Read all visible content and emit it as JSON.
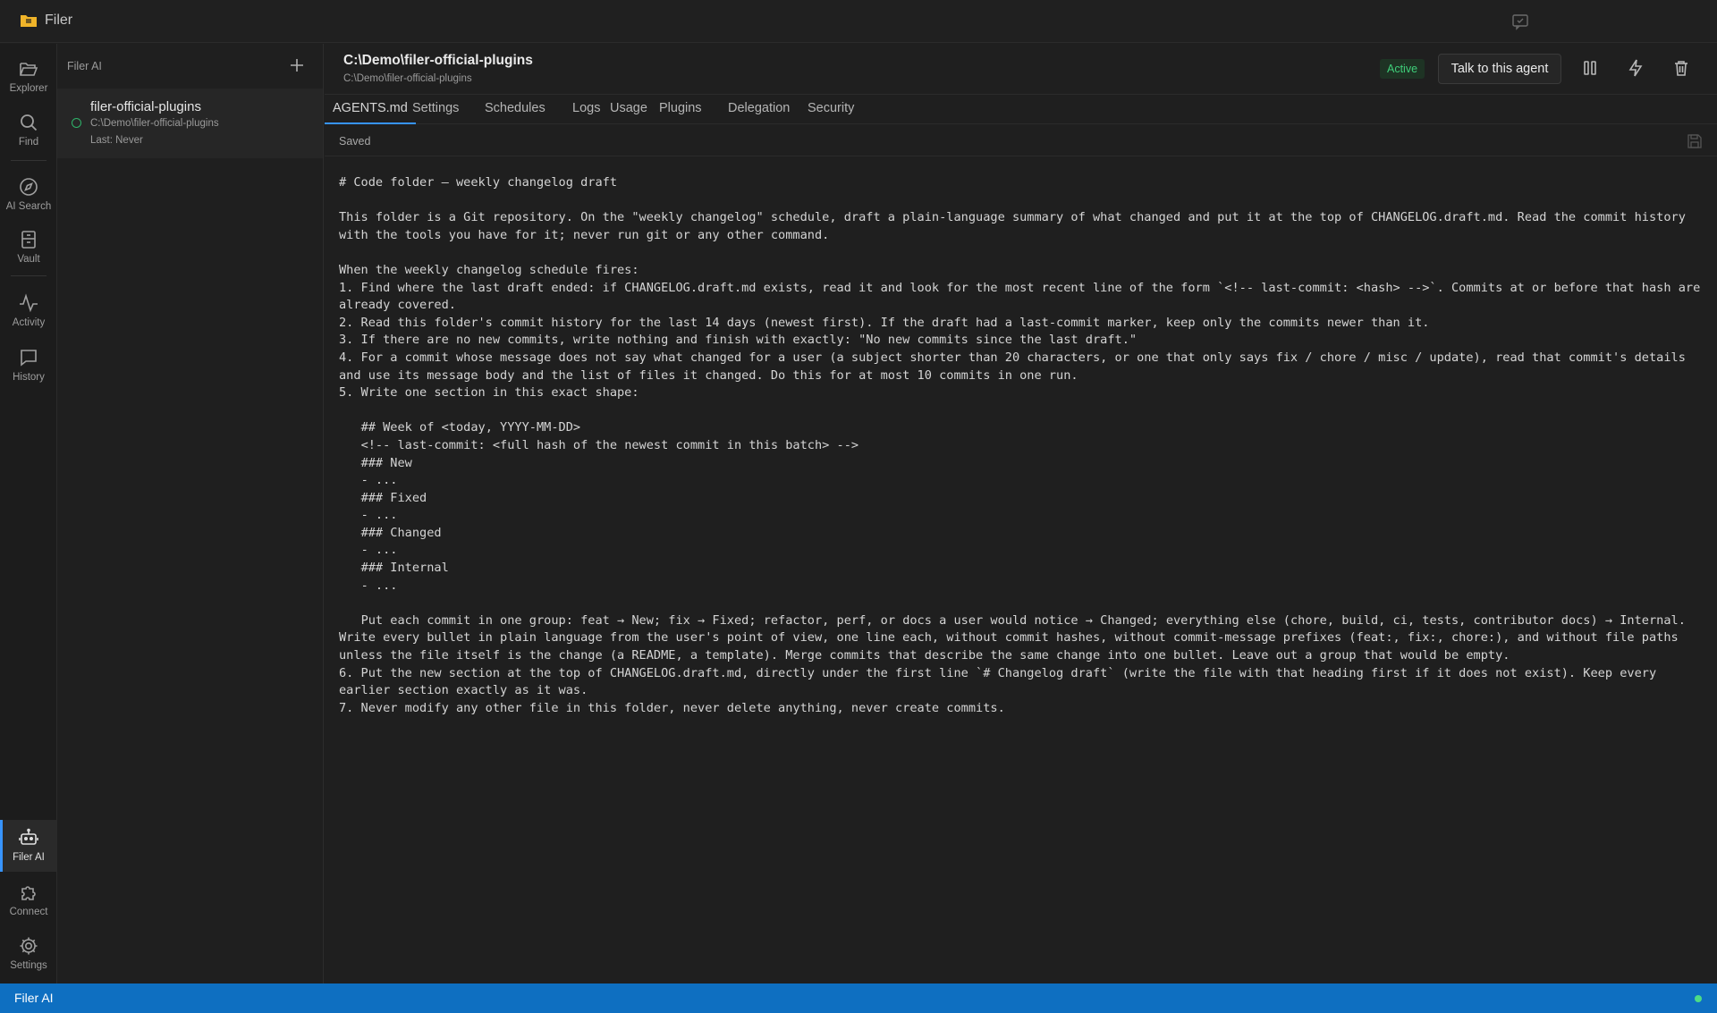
{
  "app": {
    "title": "Filer"
  },
  "rail": {
    "items": [
      {
        "id": "explorer",
        "label": "Explorer",
        "icon": "folder-open-icon"
      },
      {
        "id": "find",
        "label": "Find",
        "icon": "search-icon"
      },
      {
        "id": "ai-search",
        "label": "AI Search",
        "icon": "compass-icon"
      },
      {
        "id": "vault",
        "label": "Vault",
        "icon": "vault-icon"
      },
      {
        "id": "activity",
        "label": "Activity",
        "icon": "activity-icon"
      },
      {
        "id": "history",
        "label": "History",
        "icon": "chat-bubble-icon"
      },
      {
        "id": "filer-ai",
        "label": "Filer AI",
        "icon": "robot-icon",
        "active": true
      },
      {
        "id": "connect",
        "label": "Connect",
        "icon": "puzzle-icon"
      },
      {
        "id": "settings",
        "label": "Settings",
        "icon": "gear-icon"
      }
    ]
  },
  "agents_panel": {
    "title": "Filer AI",
    "agents": [
      {
        "name": "filer-official-plugins",
        "path": "C:\\Demo\\filer-official-plugins",
        "last": "Last: Never"
      }
    ]
  },
  "main": {
    "title": "C:\\Demo\\filer-official-plugins",
    "subpath": "C:\\Demo\\filer-official-plugins",
    "status": "Active",
    "talk_button": "Talk to this agent",
    "tabs": [
      "AGENTS.md",
      "Settings",
      "Schedules",
      "Logs",
      "Usage",
      "Plugins",
      "Delegation",
      "Security"
    ],
    "active_tab": "AGENTS.md",
    "save_status": "Saved",
    "editor_lines": [
      "# Code folder — weekly changelog draft",
      "",
      "This folder is a Git repository. On the \"weekly changelog\" schedule, draft a plain-language summary of what changed and put it at the top of CHANGELOG.draft.md. Read the commit history with the tools you have for it; never run git or any other command.",
      "",
      "When the weekly changelog schedule fires:",
      "1. Find where the last draft ended: if CHANGELOG.draft.md exists, read it and look for the most recent line of the form `<!-- last-commit: <hash> -->`. Commits at or before that hash are already covered.",
      "2. Read this folder's commit history for the last 14 days (newest first). If the draft had a last-commit marker, keep only the commits newer than it.",
      "3. If there are no new commits, write nothing and finish with exactly: \"No new commits since the last draft.\"",
      "4. For a commit whose message does not say what changed for a user (a subject shorter than 20 characters, or one that only says fix / chore / misc / update), read that commit's details and use its message body and the list of files it changed. Do this for at most 10 commits in one run.",
      "5. Write one section in this exact shape:",
      "",
      "   ## Week of <today, YYYY-MM-DD>",
      "   <!-- last-commit: <full hash of the newest commit in this batch> -->",
      "   ### New",
      "   - ...",
      "   ### Fixed",
      "   - ...",
      "   ### Changed",
      "   - ...",
      "   ### Internal",
      "   - ...",
      "",
      "   Put each commit in one group: feat → New; fix → Fixed; refactor, perf, or docs a user would notice → Changed; everything else (chore, build, ci, tests, contributor docs) → Internal. Write every bullet in plain language from the user's point of view, one line each, without commit hashes, without commit-message prefixes (feat:, fix:, chore:), and without file paths unless the file itself is the change (a README, a template). Merge commits that describe the same change into one bullet. Leave out a group that would be empty.",
      "6. Put the new section at the top of CHANGELOG.draft.md, directly under the first line `# Changelog draft` (write the file with that heading first if it does not exist). Keep every earlier section exactly as it was.",
      "7. Never modify any other file in this folder, never delete anything, never create commits."
    ]
  },
  "statusbar": {
    "label": "Filer AI"
  },
  "colors": {
    "accent": "#3794ff",
    "statusbar": "#0e6fc1",
    "active_green": "#3fcf7a"
  }
}
